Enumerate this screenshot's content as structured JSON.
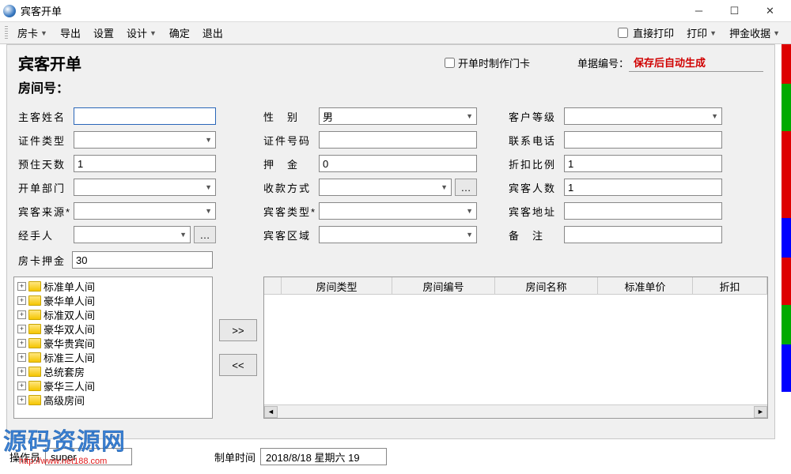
{
  "window": {
    "title": "宾客开单"
  },
  "toolbar": {
    "items": [
      "房卡",
      "导出",
      "设置",
      "设计",
      "确定",
      "退出"
    ],
    "direct_print": "直接打印",
    "print": "打印",
    "deposit_receipt": "押金收据"
  },
  "header": {
    "title": "宾客开单",
    "make_card_checkbox": "开单时制作门卡",
    "doc_no_label": "单据编号：",
    "doc_no_value": "保存后自动生成",
    "room_no_label": "房间号："
  },
  "form": {
    "guest_name": {
      "label": "主客姓名",
      "value": ""
    },
    "gender": {
      "label": "性　别",
      "value": "男"
    },
    "cust_level": {
      "label": "客户等级",
      "value": ""
    },
    "cert_type": {
      "label": "证件类型",
      "value": ""
    },
    "cert_no": {
      "label": "证件号码",
      "value": ""
    },
    "phone": {
      "label": "联系电话",
      "value": ""
    },
    "pre_days": {
      "label": "预住天数",
      "value": "1"
    },
    "deposit": {
      "label": "押　金",
      "value": "0"
    },
    "discount": {
      "label": "折扣比例",
      "value": "1"
    },
    "dept": {
      "label": "开单部门",
      "value": ""
    },
    "pay_method": {
      "label": "收款方式",
      "value": ""
    },
    "guest_count": {
      "label": "宾客人数",
      "value": "1"
    },
    "source": {
      "label": "宾客来源*",
      "value": ""
    },
    "guest_type": {
      "label": "宾客类型*",
      "value": ""
    },
    "guest_addr": {
      "label": "宾客地址",
      "value": ""
    },
    "handler": {
      "label": "经手人",
      "value": ""
    },
    "guest_area": {
      "label": "宾客区域",
      "value": ""
    },
    "remark": {
      "label": "备　注",
      "value": ""
    },
    "card_deposit": {
      "label": "房卡押金",
      "value": "30"
    }
  },
  "tree": {
    "items": [
      "标准单人间",
      "豪华单人间",
      "标准双人间",
      "豪华双人间",
      "豪华贵宾间",
      "标准三人间",
      "总统套房",
      "豪华三人间",
      "高级房间"
    ]
  },
  "mid_buttons": {
    "add": ">>",
    "remove": "<<"
  },
  "table": {
    "columns": [
      "房间类型",
      "房间编号",
      "房间名称",
      "标准单价",
      "折扣"
    ]
  },
  "status": {
    "operator_label": "操作员",
    "operator_value": "super",
    "time_label": "制单时间",
    "time_value": "2018/8/18 星期六 19"
  },
  "watermark": {
    "text": "源码资源网",
    "url": "http://www.net188.com"
  }
}
